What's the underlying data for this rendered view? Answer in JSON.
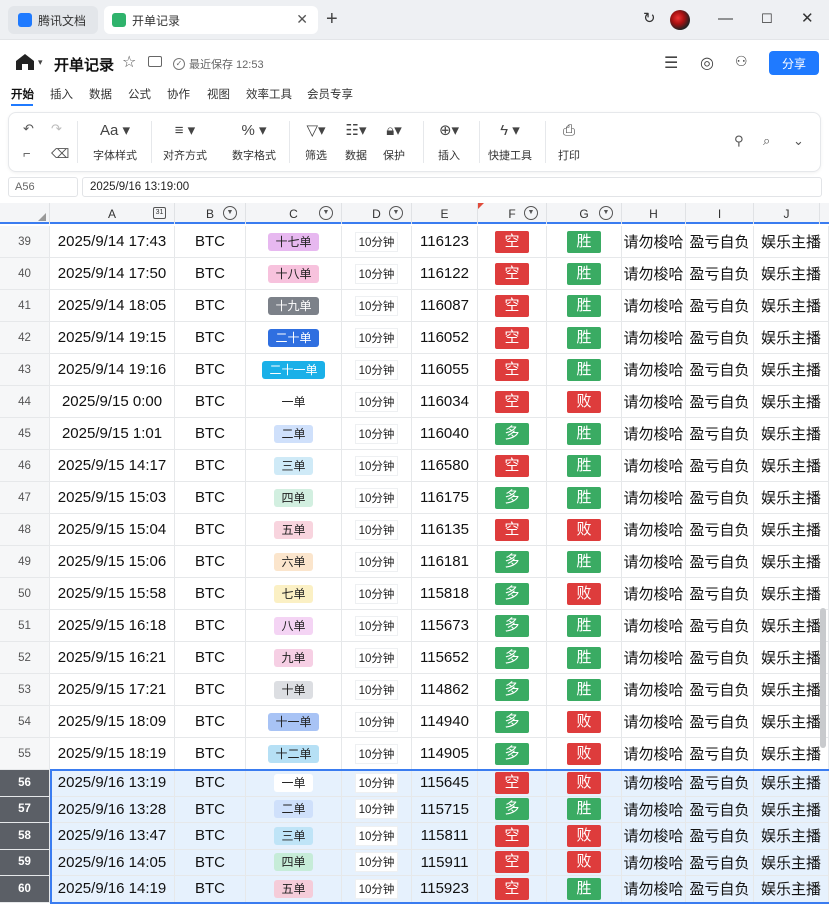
{
  "browser": {
    "tabs": [
      {
        "label": "腾讯文档",
        "icon_color": "#1f7aff"
      },
      {
        "label": "开单记录",
        "icon_color": "#2fb36c"
      }
    ]
  },
  "header": {
    "title": "开单记录",
    "saved": "最近保存 12:53",
    "share_label": "分享"
  },
  "menu": [
    "开始",
    "插入",
    "数据",
    "公式",
    "协作",
    "视图",
    "效率工具",
    "会员专享"
  ],
  "toolbar": {
    "items": [
      "字体样式",
      "对齐方式",
      "数字格式",
      "筛选",
      "数据",
      "保护",
      "插入",
      "快捷工具",
      "打印"
    ]
  },
  "formula_bar": {
    "cell_ref": "A56",
    "value": "2025/9/16 13:19:00"
  },
  "columns": [
    "A",
    "B",
    "C",
    "D",
    "E",
    "F",
    "G",
    "H",
    "I",
    "J"
  ],
  "colors": {
    "short": "#de3c3c",
    "long": "#3aab63",
    "win": "#3aab63",
    "lose": "#de3c3c",
    "accent": "#1f7aff"
  },
  "rows": [
    {
      "n": "39",
      "a": "2025/9/14 17:43",
      "b": "BTC",
      "c": "十七单",
      "cbg": "#e7b8f0",
      "d": "10分钟",
      "e": "116123",
      "f": "空",
      "g": "胜",
      "h": "请勿梭哈",
      "i": "盈亏自负",
      "j": "娱乐主播"
    },
    {
      "n": "40",
      "a": "2025/9/14 17:50",
      "b": "BTC",
      "c": "十八单",
      "cbg": "#f7c2dd",
      "d": "10分钟",
      "e": "116122",
      "f": "空",
      "g": "胜",
      "h": "请勿梭哈",
      "i": "盈亏自负",
      "j": "娱乐主播"
    },
    {
      "n": "41",
      "a": "2025/9/14 18:05",
      "b": "BTC",
      "c": "十九单",
      "cbg": "#7c8189",
      "cfg": "#fff",
      "d": "10分钟",
      "e": "116087",
      "f": "空",
      "g": "胜",
      "h": "请勿梭哈",
      "i": "盈亏自负",
      "j": "娱乐主播"
    },
    {
      "n": "42",
      "a": "2025/9/14 19:15",
      "b": "BTC",
      "c": "二十单",
      "cbg": "#2f6fe0",
      "cfg": "#fff",
      "d": "10分钟",
      "e": "116052",
      "f": "空",
      "g": "胜",
      "h": "请勿梭哈",
      "i": "盈亏自负",
      "j": "娱乐主播"
    },
    {
      "n": "43",
      "a": "2025/9/14 19:16",
      "b": "BTC",
      "c": "二十一单",
      "cbg": "#1ab0e8",
      "cfg": "#fff",
      "d": "10分钟",
      "e": "116055",
      "f": "空",
      "g": "胜",
      "h": "请勿梭哈",
      "i": "盈亏自负",
      "j": "娱乐主播"
    },
    {
      "n": "44",
      "a": "2025/9/15 0:00",
      "b": "BTC",
      "c": "一单",
      "cbg": "#ffffff",
      "d": "10分钟",
      "e": "116034",
      "f": "空",
      "g": "败",
      "h": "请勿梭哈",
      "i": "盈亏自负",
      "j": "娱乐主播"
    },
    {
      "n": "45",
      "a": "2025/9/15 1:01",
      "b": "BTC",
      "c": "二单",
      "cbg": "#cfe0fb",
      "d": "10分钟",
      "e": "116040",
      "f": "多",
      "g": "胜",
      "h": "请勿梭哈",
      "i": "盈亏自负",
      "j": "娱乐主播"
    },
    {
      "n": "46",
      "a": "2025/9/15 14:17",
      "b": "BTC",
      "c": "三单",
      "cbg": "#cfeaf7",
      "d": "10分钟",
      "e": "116580",
      "f": "空",
      "g": "胜",
      "h": "请勿梭哈",
      "i": "盈亏自负",
      "j": "娱乐主播"
    },
    {
      "n": "47",
      "a": "2025/9/15 15:03",
      "b": "BTC",
      "c": "四单",
      "cbg": "#d2efe0",
      "d": "10分钟",
      "e": "116175",
      "f": "多",
      "g": "胜",
      "h": "请勿梭哈",
      "i": "盈亏自负",
      "j": "娱乐主播"
    },
    {
      "n": "48",
      "a": "2025/9/15 15:04",
      "b": "BTC",
      "c": "五单",
      "cbg": "#f8d4de",
      "d": "10分钟",
      "e": "116135",
      "f": "空",
      "g": "败",
      "h": "请勿梭哈",
      "i": "盈亏自负",
      "j": "娱乐主播"
    },
    {
      "n": "49",
      "a": "2025/9/15 15:06",
      "b": "BTC",
      "c": "六单",
      "cbg": "#fbe5cc",
      "d": "10分钟",
      "e": "116181",
      "f": "多",
      "g": "胜",
      "h": "请勿梭哈",
      "i": "盈亏自负",
      "j": "娱乐主播"
    },
    {
      "n": "50",
      "a": "2025/9/15 15:58",
      "b": "BTC",
      "c": "七单",
      "cbg": "#fbf0c4",
      "d": "10分钟",
      "e": "115818",
      "f": "多",
      "g": "败",
      "h": "请勿梭哈",
      "i": "盈亏自负",
      "j": "娱乐主播"
    },
    {
      "n": "51",
      "a": "2025/9/15 16:18",
      "b": "BTC",
      "c": "八单",
      "cbg": "#f4d4f4",
      "d": "10分钟",
      "e": "115673",
      "f": "多",
      "g": "胜",
      "h": "请勿梭哈",
      "i": "盈亏自负",
      "j": "娱乐主播"
    },
    {
      "n": "52",
      "a": "2025/9/15 16:21",
      "b": "BTC",
      "c": "九单",
      "cbg": "#f6cfe4",
      "d": "10分钟",
      "e": "115652",
      "f": "多",
      "g": "胜",
      "h": "请勿梭哈",
      "i": "盈亏自负",
      "j": "娱乐主播"
    },
    {
      "n": "53",
      "a": "2025/9/15 17:21",
      "b": "BTC",
      "c": "十单",
      "cbg": "#dcdee2",
      "d": "10分钟",
      "e": "114862",
      "f": "多",
      "g": "胜",
      "h": "请勿梭哈",
      "i": "盈亏自负",
      "j": "娱乐主播"
    },
    {
      "n": "54",
      "a": "2025/9/15 18:09",
      "b": "BTC",
      "c": "十一单",
      "cbg": "#a8c3f5",
      "d": "10分钟",
      "e": "114940",
      "f": "多",
      "g": "败",
      "h": "请勿梭哈",
      "i": "盈亏自负",
      "j": "娱乐主播"
    },
    {
      "n": "55",
      "a": "2025/9/15 18:19",
      "b": "BTC",
      "c": "十二单",
      "cbg": "#b6e0f5",
      "d": "10分钟",
      "e": "114905",
      "f": "多",
      "g": "败",
      "h": "请勿梭哈",
      "i": "盈亏自负",
      "j": "娱乐主播"
    },
    {
      "n": "56",
      "a": "2025/9/16 13:19",
      "b": "BTC",
      "c": "一单",
      "cbg": "#ffffff",
      "d": "10分钟",
      "e": "115645",
      "f": "空",
      "g": "败",
      "h": "请勿梭哈",
      "i": "盈亏自负",
      "j": "娱乐主播",
      "sel": true
    },
    {
      "n": "57",
      "a": "2025/9/16 13:28",
      "b": "BTC",
      "c": "二单",
      "cbg": "#cfe0fb",
      "d": "10分钟",
      "e": "115715",
      "f": "多",
      "g": "胜",
      "h": "请勿梭哈",
      "i": "盈亏自负",
      "j": "娱乐主播",
      "sel": true
    },
    {
      "n": "58",
      "a": "2025/9/16 13:47",
      "b": "BTC",
      "c": "三单",
      "cbg": "#bfe4f7",
      "d": "10分钟",
      "e": "115811",
      "f": "空",
      "g": "败",
      "h": "请勿梭哈",
      "i": "盈亏自负",
      "j": "娱乐主播",
      "sel": true
    },
    {
      "n": "59",
      "a": "2025/9/16 14:05",
      "b": "BTC",
      "c": "四单",
      "cbg": "#c6ecd8",
      "d": "10分钟",
      "e": "115911",
      "f": "空",
      "g": "败",
      "h": "请勿梭哈",
      "i": "盈亏自负",
      "j": "娱乐主播",
      "sel": true
    },
    {
      "n": "60",
      "a": "2025/9/16 14:19",
      "b": "BTC",
      "c": "五单",
      "cbg": "#f5ccd9",
      "d": "10分钟",
      "e": "115923",
      "f": "空",
      "g": "胜",
      "h": "请勿梭哈",
      "i": "盈亏自负",
      "j": "娱乐主播",
      "sel": true
    }
  ]
}
